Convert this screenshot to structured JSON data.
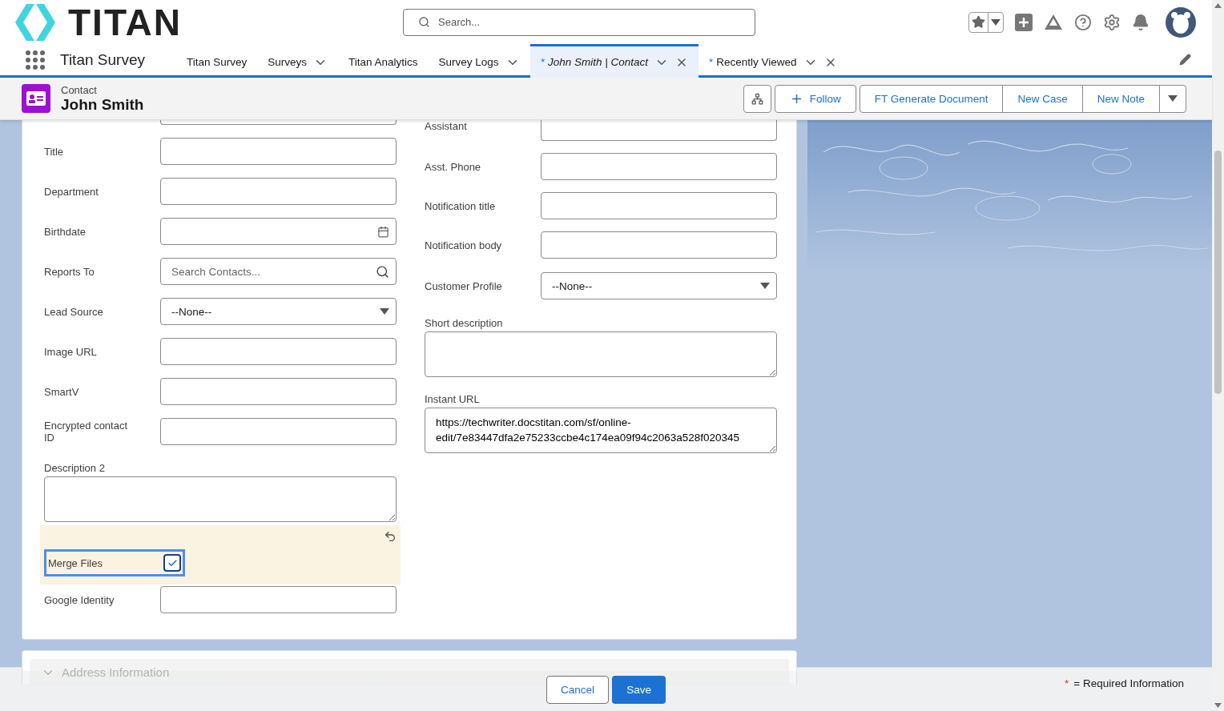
{
  "brand": {
    "logo_text": "TITAN"
  },
  "search": {
    "placeholder": "Search..."
  },
  "app_name": "Titan Survey",
  "nav_tabs": [
    {
      "label": "Titan Survey",
      "selected": false,
      "has_menu": false,
      "closable": false
    },
    {
      "label": "Surveys",
      "selected": false,
      "has_menu": true,
      "closable": false
    },
    {
      "label": "Titan Analytics",
      "selected": false,
      "has_menu": false,
      "closable": false
    },
    {
      "label": "Survey Logs",
      "selected": false,
      "has_menu": true,
      "closable": false
    },
    {
      "marker": "*",
      "label": "John Smith | Contact",
      "selected": true,
      "has_menu": true,
      "closable": true
    },
    {
      "marker": "*",
      "label": "Recently Viewed",
      "selected": false,
      "has_menu": true,
      "closable": true
    }
  ],
  "record": {
    "type": "Contact",
    "name": "John Smith"
  },
  "actions": {
    "follow": "Follow",
    "group": [
      "FT Generate Document",
      "New Case",
      "New Note"
    ]
  },
  "left_fields": [
    {
      "kind": "sliver"
    },
    {
      "kind": "text",
      "label": "Title"
    },
    {
      "kind": "text",
      "label": "Department"
    },
    {
      "kind": "date",
      "label": "Birthdate"
    },
    {
      "kind": "lookup",
      "label": "Reports To",
      "placeholder": "Search Contacts..."
    },
    {
      "kind": "select",
      "label": "Lead Source",
      "value": "--None--"
    },
    {
      "kind": "text",
      "label": "Image URL"
    },
    {
      "kind": "text",
      "label": "SmartV"
    },
    {
      "kind": "text",
      "label": "Encrypted contact ID"
    },
    {
      "kind": "textarea",
      "label": "Description 2"
    },
    {
      "kind": "checkbox",
      "label": "Merge Files",
      "checked": true,
      "edited": true
    },
    {
      "kind": "text",
      "label": "Google Identity"
    }
  ],
  "right_fields": [
    {
      "kind": "cut",
      "label": "Assistant"
    },
    {
      "kind": "text",
      "label": "Asst. Phone"
    },
    {
      "kind": "text",
      "label": "Notification title"
    },
    {
      "kind": "text",
      "label": "Notification body"
    },
    {
      "kind": "select",
      "label": "Customer Profile",
      "value": "--None--"
    },
    {
      "kind": "textarea",
      "label": "Short description"
    },
    {
      "kind": "url",
      "label": "Instant URL",
      "value": "https://techwriter.docstitan.com/sf/online-\nedit/7e83447dfa2e75233ccbe4c174ea09f94c2063a528f020345"
    }
  ],
  "next_section": {
    "title": "Address Information"
  },
  "footer": {
    "cancel": "Cancel",
    "save": "Save",
    "required_marker": "*",
    "required_text": "= Required Information"
  }
}
